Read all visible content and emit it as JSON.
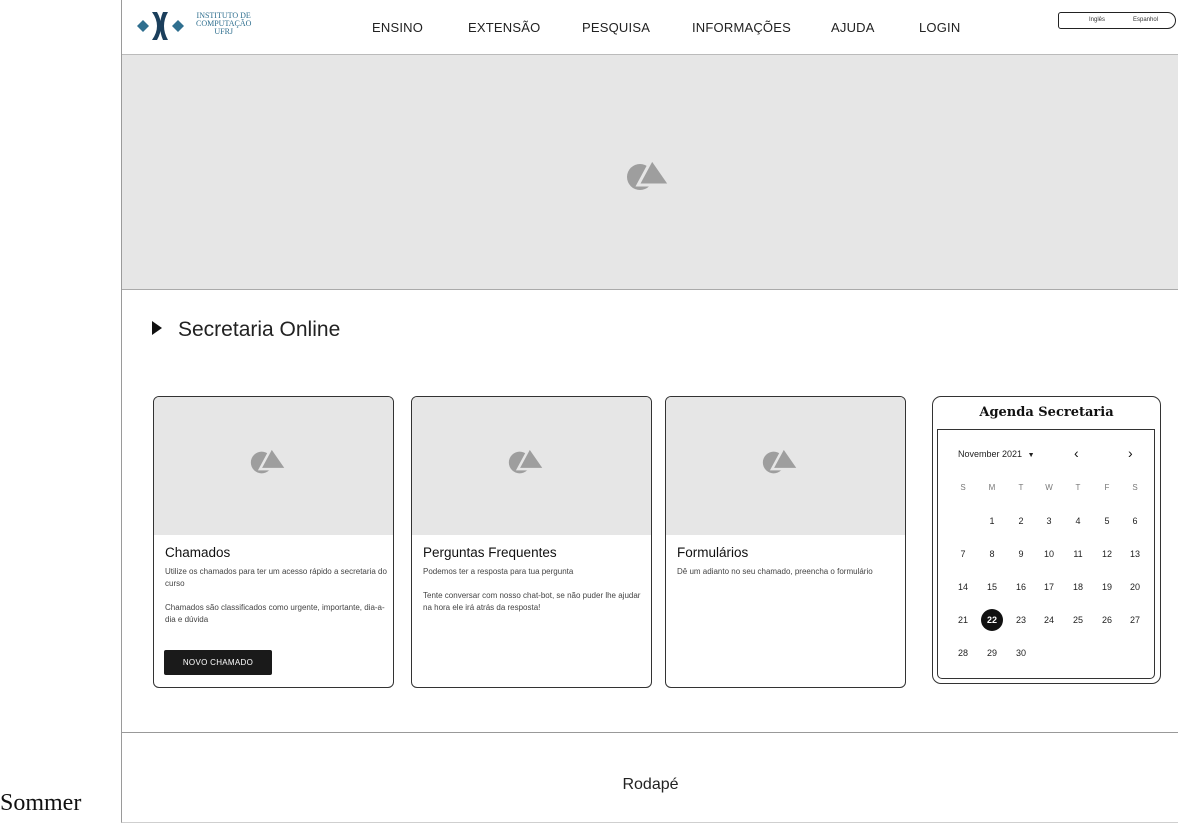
{
  "outside_label": "Sommer",
  "header": {
    "logo_lines": [
      "INSTITUTO DE",
      "COMPUTAÇÃO",
      "UFRJ"
    ],
    "nav": [
      "ENSINO",
      "EXTENSÃO",
      "PESQUISA",
      "INFORMAÇÕES",
      "AJUDA",
      "LOGIN"
    ],
    "languages": [
      "Inglês",
      "Espanhol"
    ]
  },
  "section": {
    "title": "Secretaria Online"
  },
  "cards": [
    {
      "title": "Chamados",
      "paragraphs": [
        "Utilize os chamados para ter um acesso rápido a secretaria do curso",
        "Chamados são classificados como urgente, importante, dia-a-dia e dúvida"
      ],
      "button": "NOVO CHAMADO"
    },
    {
      "title": "Perguntas Frequentes",
      "paragraphs": [
        "Podemos ter a resposta para tua pergunta",
        "Tente conversar com nosso chat-bot, se não puder lhe ajudar na hora ele irá atrás da resposta!"
      ]
    },
    {
      "title": "Formulários",
      "paragraphs": [
        "Dê um adianto no seu chamado, preencha o formulário"
      ]
    }
  ],
  "calendar": {
    "title": "Agenda Secretaria",
    "month": "November 2021",
    "dropdown_icon": "caret-down",
    "prev_icon": "chevron-left",
    "next_icon": "chevron-right",
    "weekdays": [
      "S",
      "M",
      "T",
      "W",
      "T",
      "F",
      "S"
    ],
    "first_weekday_index": 1,
    "days_in_month": 30,
    "selected_day": 22
  },
  "footer": {
    "text": "Rodapé"
  },
  "colors": {
    "placeholder_bg": "#e6e6e6",
    "icon": "#9e9e9e",
    "button_bg": "#1a1a1a",
    "logo": "#2f6f8f"
  }
}
